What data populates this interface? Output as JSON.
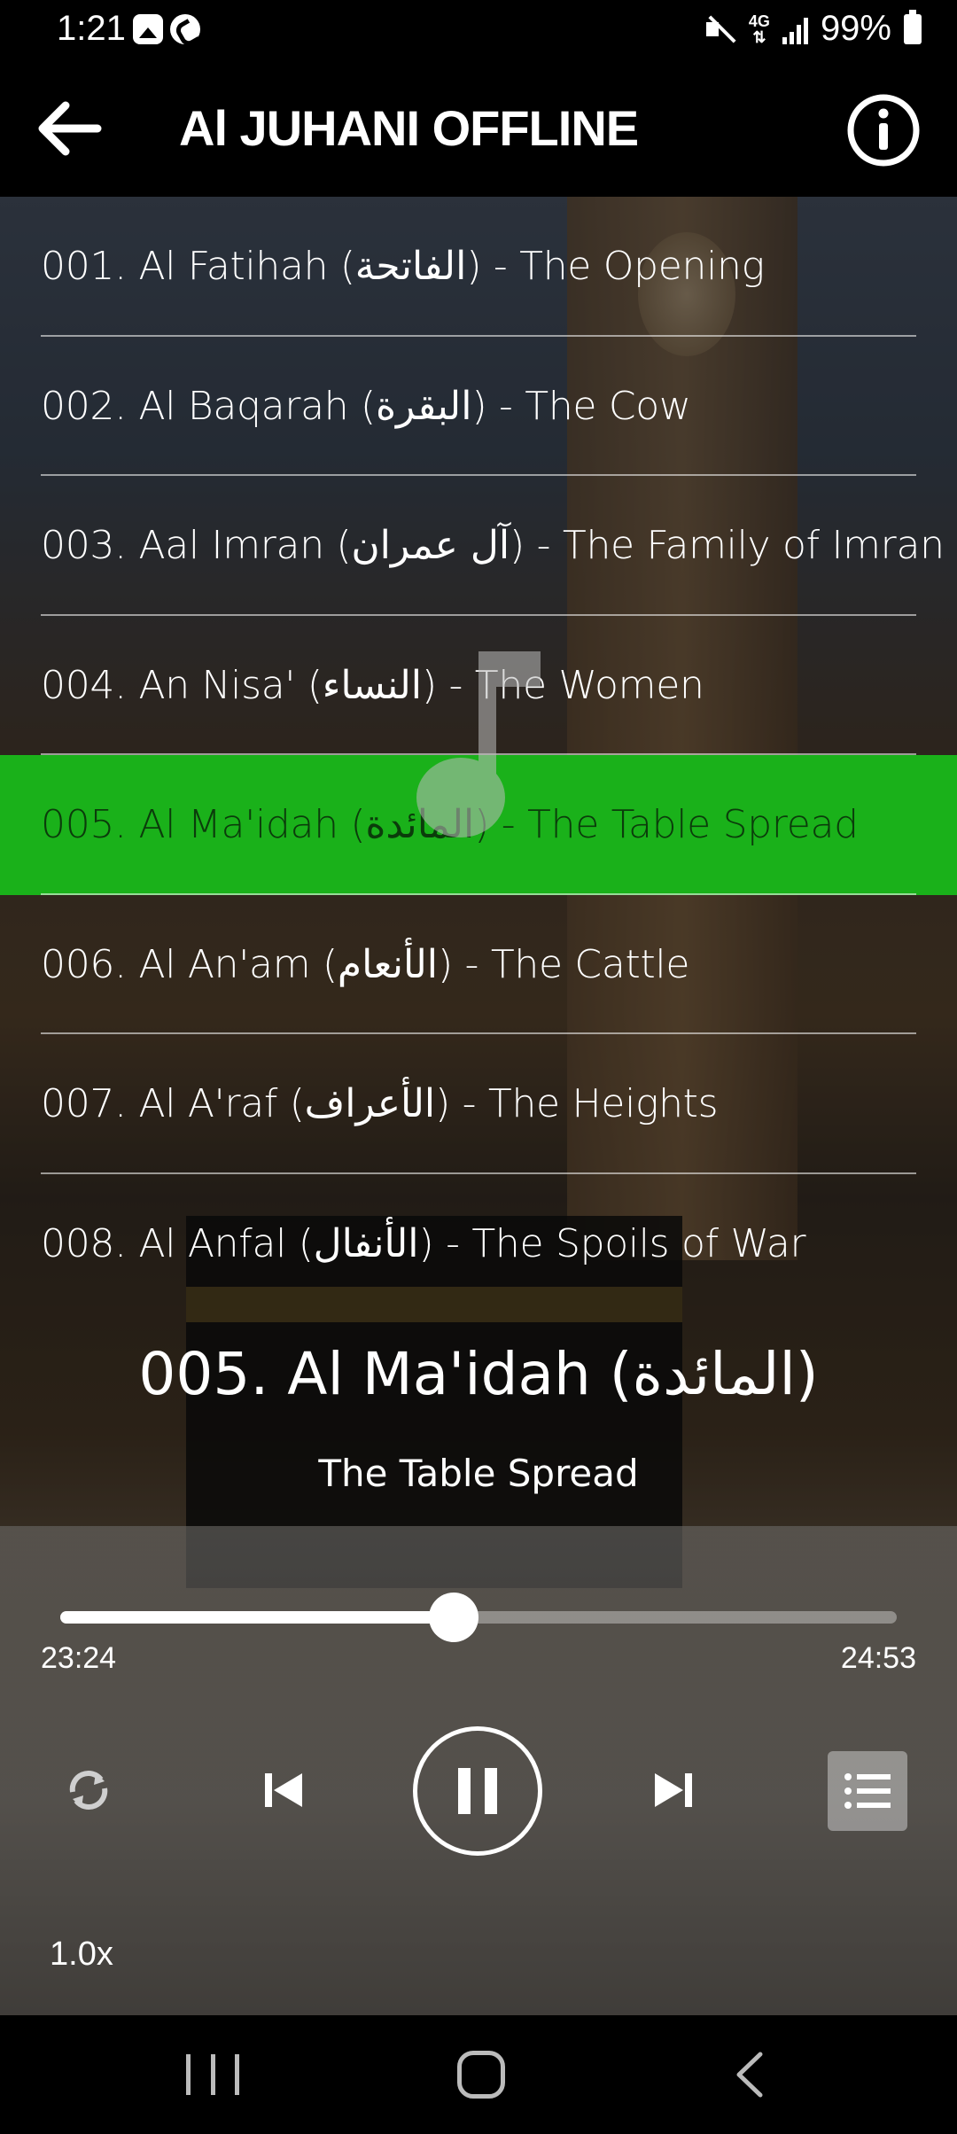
{
  "status_bar": {
    "time": "1:21",
    "network": "4G",
    "battery": "99%"
  },
  "app_bar": {
    "title": "Al JUHANI OFFLINE",
    "back_icon": "arrow-left-icon",
    "info_icon": "info-icon"
  },
  "tracks": [
    {
      "label": "001. Al Fatihah (الفاتحة) - The Opening",
      "active": false
    },
    {
      "label": "002. Al Baqarah (البقرة) - The Cow",
      "active": false
    },
    {
      "label": "003. Aal Imran (آل عمران) - The Family of Imran",
      "active": false
    },
    {
      "label": "004. An Nisa' (النساء) - The Women",
      "active": false
    },
    {
      "label": "005. Al Ma'idah (المائدة) - The Table Spread",
      "active": true
    },
    {
      "label": "006. Al An'am (الأنعام) - The Cattle",
      "active": false
    },
    {
      "label": "007. Al A'raf (الأعراف) - The Heights",
      "active": false
    },
    {
      "label": "008. Al Anfal (الأنفال) - The Spoils of War",
      "active": false
    }
  ],
  "now_playing": {
    "title": "005. Al Ma'idah (المائدة)",
    "subtitle": "The Table Spread",
    "current_time": "23:24",
    "total_time": "24:53",
    "progress": 0.47,
    "speed": "1.0x"
  },
  "controls": {
    "repeat": "repeat-icon",
    "previous": "skip-previous-icon",
    "play_pause": "pause-icon",
    "next": "skip-next-icon",
    "playlist": "list-icon"
  },
  "colors": {
    "active_row": "#1ab11a",
    "bar_bg": "#000000"
  }
}
